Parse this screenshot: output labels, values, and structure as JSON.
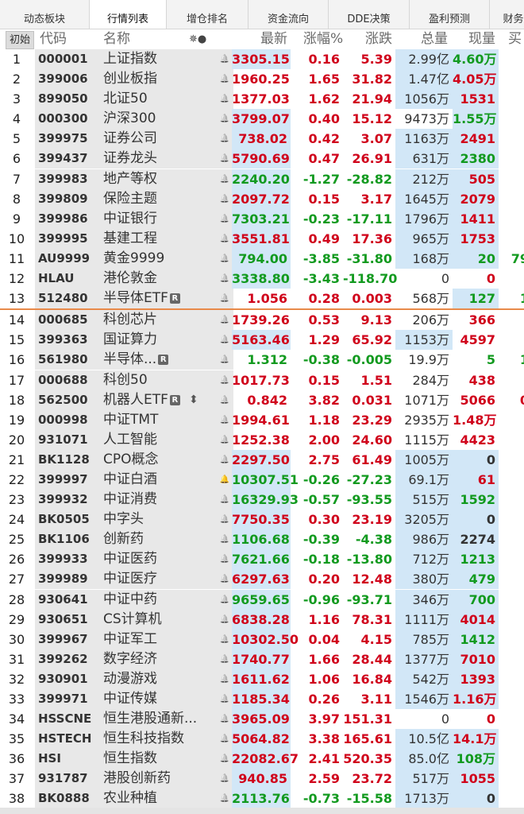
{
  "tabs": [
    "动态板块",
    "行情列表",
    "增仓排名",
    "资金流向",
    "DDE决策",
    "盈利预测",
    "财务"
  ],
  "active_tab": 1,
  "header": {
    "init": "初始",
    "code": "代码",
    "name": "名称",
    "icons": "✵●",
    "price": "最新",
    "pct": "涨幅%",
    "chg": "涨跌",
    "vol": "总量",
    "cur": "现量",
    "buy": "买"
  },
  "colors": {
    "up": "#d0021b",
    "down": "#129a1f",
    "highlight": "#d2e7f7",
    "separator": "#e88a4a"
  },
  "rows": [
    {
      "i": "1",
      "code": "000001",
      "name": "上证指数",
      "price": "3305.15",
      "pct": "0.16",
      "chg": "5.39",
      "vol": "2.99亿",
      "cur": "4.60万",
      "buy": "",
      "dir": "up",
      "cdir": "dn",
      "hp": 1,
      "hv": 1,
      "hc": 1
    },
    {
      "i": "2",
      "code": "399006",
      "name": "创业板指",
      "price": "1960.25",
      "pct": "1.65",
      "chg": "31.82",
      "vol": "1.47亿",
      "cur": "4.05万",
      "buy": "",
      "dir": "up",
      "cdir": "up",
      "hp": 0,
      "hv": 1,
      "hc": 1
    },
    {
      "i": "3",
      "code": "899050",
      "name": "北证50",
      "price": "1377.03",
      "pct": "1.62",
      "chg": "21.94",
      "vol": "1056万",
      "cur": "1531",
      "buy": "",
      "dir": "up",
      "cdir": "up",
      "hp": 0,
      "hv": 1,
      "hc": 1
    },
    {
      "i": "4",
      "code": "000300",
      "name": "沪深300",
      "price": "3799.07",
      "pct": "0.40",
      "chg": "15.12",
      "vol": "9473万",
      "cur": "1.55万",
      "buy": "",
      "dir": "up",
      "cdir": "dn",
      "hp": 1,
      "hv": 0,
      "hc": 1
    },
    {
      "i": "5",
      "code": "399975",
      "name": "证券公司",
      "price": "738.02",
      "pct": "0.42",
      "chg": "3.07",
      "vol": "1163万",
      "cur": "2491",
      "buy": "",
      "dir": "up",
      "cdir": "up",
      "hp": 1,
      "hv": 1,
      "hc": 1
    },
    {
      "i": "6",
      "code": "399437",
      "name": "证券龙头",
      "price": "5790.69",
      "pct": "0.47",
      "chg": "26.91",
      "vol": "631万",
      "cur": "2380",
      "buy": "",
      "dir": "up",
      "cdir": "dn",
      "hp": 1,
      "hv": 1,
      "hc": 1
    },
    {
      "i": "7",
      "code": "399983",
      "name": "地产等权",
      "price": "2240.20",
      "pct": "-1.27",
      "chg": "-28.82",
      "vol": "212万",
      "cur": "505",
      "buy": "",
      "dir": "dn",
      "cdir": "up",
      "hp": 1,
      "hv": 1,
      "hc": 1
    },
    {
      "i": "8",
      "code": "399809",
      "name": "保险主题",
      "price": "2097.72",
      "pct": "0.15",
      "chg": "3.17",
      "vol": "1645万",
      "cur": "2079",
      "buy": "",
      "dir": "up",
      "cdir": "up",
      "hp": 1,
      "hv": 1,
      "hc": 1
    },
    {
      "i": "9",
      "code": "399986",
      "name": "中证银行",
      "price": "7303.21",
      "pct": "-0.23",
      "chg": "-17.11",
      "vol": "1796万",
      "cur": "1411",
      "buy": "",
      "dir": "dn",
      "cdir": "up",
      "hp": 1,
      "hv": 1,
      "hc": 1
    },
    {
      "i": "10",
      "code": "399995",
      "name": "基建工程",
      "price": "3551.81",
      "pct": "0.49",
      "chg": "17.36",
      "vol": "965万",
      "cur": "1753",
      "buy": "",
      "dir": "up",
      "cdir": "up",
      "hp": 1,
      "hv": 1,
      "hc": 1
    },
    {
      "i": "11",
      "code": "AU9999",
      "name": "黄金9999",
      "price": "794.00",
      "pct": "-3.85",
      "chg": "-31.80",
      "vol": "168万",
      "cur": "20",
      "buy": "79",
      "dir": "dn",
      "cdir": "dn",
      "hp": 1,
      "hv": 1,
      "hc": 1
    },
    {
      "i": "12",
      "code": "HLAU",
      "name": "港伦敦金",
      "price": "3338.80",
      "pct": "-3.43",
      "chg": "-118.70",
      "vol": "0",
      "cur": "0",
      "buy": "",
      "dir": "dn",
      "cdir": "up",
      "hp": 1,
      "hv": 0,
      "hc": 0
    },
    {
      "i": "13",
      "code": "512480",
      "name": "半导体ETF",
      "badge": "R",
      "price": "1.056",
      "pct": "0.28",
      "chg": "0.003",
      "vol": "568万",
      "cur": "127",
      "buy": "1",
      "dir": "up",
      "cdir": "dn",
      "hp": 0,
      "hv": 0,
      "hc": 1,
      "sep": 1
    },
    {
      "i": "14",
      "code": "000685",
      "name": "科创芯片",
      "price": "1739.26",
      "pct": "0.53",
      "chg": "9.13",
      "vol": "206万",
      "cur": "366",
      "buy": "",
      "dir": "up",
      "cdir": "up",
      "hp": 0,
      "hv": 0,
      "hc": 0
    },
    {
      "i": "15",
      "code": "399363",
      "name": "国证算力",
      "price": "5163.46",
      "pct": "1.29",
      "chg": "65.92",
      "vol": "1153万",
      "cur": "4597",
      "buy": "",
      "dir": "up",
      "cdir": "up",
      "hp": 1,
      "hv": 1,
      "hc": 0
    },
    {
      "i": "16",
      "code": "561980",
      "name": "半导体...",
      "badge": "R",
      "price": "1.312",
      "pct": "-0.38",
      "chg": "-0.005",
      "vol": "19.9万",
      "cur": "5",
      "buy": "1",
      "dir": "dn",
      "cdir": "dn",
      "hp": 0,
      "hv": 0,
      "hc": 0
    },
    {
      "i": "17",
      "code": "000688",
      "name": "科创50",
      "price": "1017.73",
      "pct": "0.15",
      "chg": "1.51",
      "vol": "284万",
      "cur": "438",
      "buy": "",
      "dir": "up",
      "cdir": "up",
      "hp": 0,
      "hv": 0,
      "hc": 0
    },
    {
      "i": "18",
      "code": "562500",
      "name": "机器人ETF",
      "badge": "R",
      "sort": "⬍",
      "price": "0.842",
      "pct": "3.82",
      "chg": "0.031",
      "vol": "1071万",
      "cur": "5066",
      "buy": "0",
      "dir": "up",
      "cdir": "up",
      "hp": 0,
      "hv": 0,
      "hc": 0
    },
    {
      "i": "19",
      "code": "000998",
      "name": "中证TMT",
      "price": "1994.61",
      "pct": "1.18",
      "chg": "23.29",
      "vol": "2935万",
      "cur": "1.48万",
      "buy": "",
      "dir": "up",
      "cdir": "up",
      "hp": 0,
      "hv": 0,
      "hc": 0
    },
    {
      "i": "20",
      "code": "931071",
      "name": "人工智能",
      "price": "1252.38",
      "pct": "2.00",
      "chg": "24.60",
      "vol": "1115万",
      "cur": "4423",
      "buy": "",
      "dir": "up",
      "cdir": "up",
      "hp": 0,
      "hv": 0,
      "hc": 0
    },
    {
      "i": "21",
      "code": "BK1128",
      "name": "CPO概念",
      "price": "2297.50",
      "pct": "2.75",
      "chg": "61.49",
      "vol": "1005万",
      "cur": "0",
      "buy": "",
      "dir": "up",
      "cdir": "neu",
      "hp": 1,
      "hv": 1,
      "hc": 1
    },
    {
      "i": "22",
      "code": "399997",
      "name": "中证白酒",
      "alarm": 1,
      "price": "10307.51",
      "pct": "-0.26",
      "chg": "-27.23",
      "vol": "69.1万",
      "cur": "61",
      "buy": "",
      "dir": "dn",
      "cdir": "up",
      "hp": 1,
      "hv": 1,
      "hc": 1
    },
    {
      "i": "23",
      "code": "399932",
      "name": "中证消费",
      "price": "16329.93",
      "pct": "-0.57",
      "chg": "-93.55",
      "vol": "515万",
      "cur": "1592",
      "buy": "",
      "dir": "dn",
      "cdir": "dn",
      "hp": 1,
      "hv": 1,
      "hc": 1
    },
    {
      "i": "24",
      "code": "BK0505",
      "name": "中字头",
      "price": "7750.35",
      "pct": "0.30",
      "chg": "23.19",
      "vol": "3205万",
      "cur": "0",
      "buy": "",
      "dir": "up",
      "cdir": "neu",
      "hp": 1,
      "hv": 1,
      "hc": 1
    },
    {
      "i": "25",
      "code": "BK1106",
      "name": "创新药",
      "price": "1106.68",
      "pct": "-0.39",
      "chg": "-4.38",
      "vol": "986万",
      "cur": "2274",
      "buy": "",
      "dir": "dn",
      "cdir": "neu",
      "hp": 1,
      "hv": 1,
      "hc": 1
    },
    {
      "i": "26",
      "code": "399933",
      "name": "中证医药",
      "price": "7621.66",
      "pct": "-0.18",
      "chg": "-13.80",
      "vol": "712万",
      "cur": "1213",
      "buy": "",
      "dir": "dn",
      "cdir": "dn",
      "hp": 1,
      "hv": 1,
      "hc": 1
    },
    {
      "i": "27",
      "code": "399989",
      "name": "中证医疗",
      "price": "6297.63",
      "pct": "0.20",
      "chg": "12.48",
      "vol": "380万",
      "cur": "479",
      "buy": "",
      "dir": "up",
      "cdir": "dn",
      "hp": 1,
      "hv": 1,
      "hc": 1
    },
    {
      "i": "28",
      "code": "930641",
      "name": "中证中药",
      "price": "9659.65",
      "pct": "-0.96",
      "chg": "-93.71",
      "vol": "346万",
      "cur": "700",
      "buy": "",
      "dir": "dn",
      "cdir": "dn",
      "hp": 1,
      "hv": 1,
      "hc": 1
    },
    {
      "i": "29",
      "code": "930651",
      "name": "CS计算机",
      "price": "6838.28",
      "pct": "1.16",
      "chg": "78.31",
      "vol": "1111万",
      "cur": "4014",
      "buy": "",
      "dir": "up",
      "cdir": "up",
      "hp": 1,
      "hv": 1,
      "hc": 1
    },
    {
      "i": "30",
      "code": "399967",
      "name": "中证军工",
      "price": "10302.50",
      "pct": "0.04",
      "chg": "4.15",
      "vol": "785万",
      "cur": "1412",
      "buy": "",
      "dir": "up",
      "cdir": "dn",
      "hp": 1,
      "hv": 1,
      "hc": 1
    },
    {
      "i": "31",
      "code": "399262",
      "name": "数字经济",
      "price": "1740.77",
      "pct": "1.66",
      "chg": "28.44",
      "vol": "1377万",
      "cur": "7010",
      "buy": "",
      "dir": "up",
      "cdir": "up",
      "hp": 1,
      "hv": 1,
      "hc": 1
    },
    {
      "i": "32",
      "code": "930901",
      "name": "动漫游戏",
      "price": "1611.62",
      "pct": "1.06",
      "chg": "16.84",
      "vol": "542万",
      "cur": "1393",
      "buy": "",
      "dir": "up",
      "cdir": "up",
      "hp": 1,
      "hv": 1,
      "hc": 1
    },
    {
      "i": "33",
      "code": "399971",
      "name": "中证传媒",
      "price": "1185.34",
      "pct": "0.26",
      "chg": "3.11",
      "vol": "1546万",
      "cur": "1.16万",
      "buy": "",
      "dir": "up",
      "cdir": "up",
      "hp": 1,
      "hv": 1,
      "hc": 1
    },
    {
      "i": "34",
      "code": "HSSCNE",
      "name": "恒生港股通新...",
      "price": "3965.09",
      "pct": "3.97",
      "chg": "151.31",
      "vol": "0",
      "cur": "0",
      "buy": "",
      "dir": "up",
      "cdir": "up",
      "hp": 1,
      "hv": 0,
      "hc": 0
    },
    {
      "i": "35",
      "code": "HSTECH",
      "name": "恒生科技指数",
      "price": "5064.82",
      "pct": "3.38",
      "chg": "165.61",
      "vol": "10.5亿",
      "cur": "14.1万",
      "buy": "",
      "dir": "up",
      "cdir": "up",
      "hp": 1,
      "hv": 1,
      "hc": 1
    },
    {
      "i": "36",
      "code": "HSI",
      "name": "恒生指数",
      "price": "22082.67",
      "pct": "2.41",
      "chg": "520.35",
      "vol": "85.0亿",
      "cur": "108万",
      "buy": "",
      "dir": "up",
      "cdir": "dn",
      "hp": 1,
      "hv": 1,
      "hc": 1
    },
    {
      "i": "37",
      "code": "931787",
      "name": "港股创新药",
      "price": "940.85",
      "pct": "2.59",
      "chg": "23.72",
      "vol": "517万",
      "cur": "1055",
      "buy": "",
      "dir": "up",
      "cdir": "up",
      "hp": 1,
      "hv": 1,
      "hc": 1
    },
    {
      "i": "38",
      "code": "BK0888",
      "name": "农业种植",
      "price": "2113.76",
      "pct": "-0.73",
      "chg": "-15.58",
      "vol": "1713万",
      "cur": "0",
      "buy": "",
      "dir": "dn",
      "cdir": "neu",
      "hp": 1,
      "hv": 1,
      "hc": 1
    }
  ]
}
